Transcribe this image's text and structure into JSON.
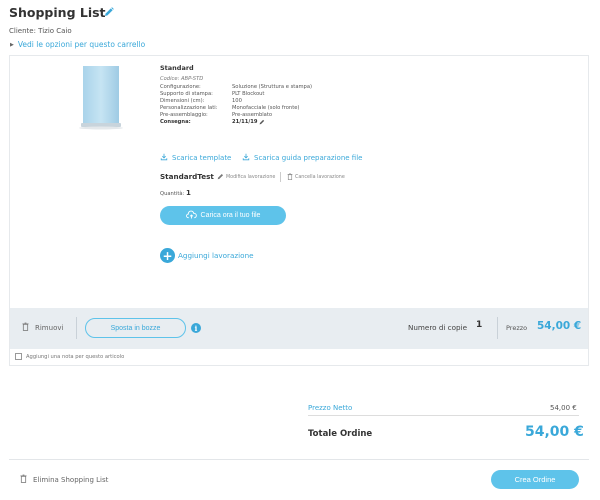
{
  "header": {
    "title": "Shopping List",
    "client": "Cliente: Tizio Caio",
    "options_link": "Vedi le opzioni per questo carrello"
  },
  "product": {
    "name": "Standard",
    "code": "Codice: ABP-STD",
    "specs": [
      {
        "key": "Configurazione:",
        "value": "Soluzione (Struttura e stampa)"
      },
      {
        "key": "Supporto di stampa:",
        "value": "PLT Blockout"
      },
      {
        "key": "Dimensioni (cm):",
        "value": "100"
      },
      {
        "key": "Personalizzazione lati:",
        "value": "Monofacciale (solo fronte)"
      },
      {
        "key": "Pre-assemblaggio:",
        "value": "Pre-assemblato"
      }
    ],
    "delivery_key": "Consegna:",
    "delivery_value": "21/11/19",
    "download_template": "Scarica template",
    "download_guide": "Scarica guida preparazione file",
    "processing": {
      "name": "StandardTest",
      "edit_label": "Modifica lavorazione",
      "cancel_label": "Cancella lavorazione",
      "quantity_label": "Quantità:",
      "quantity_value": "1"
    },
    "upload_label": "Carica ora il tuo file",
    "add_processing_label": "Aggiungi lavorazione"
  },
  "action_bar": {
    "remove_label": "Rimuovi",
    "move_label": "Sposta in bozze",
    "copies_label": "Numero di copie",
    "copies_value": "1",
    "price_label": "Prezzo",
    "price_value": "54,00 €"
  },
  "note_label": "Aggiungi una nota per questo articolo",
  "totals": {
    "net_label": "Prezzo Netto",
    "net_value": "54,00 €",
    "total_label": "Totale Ordine",
    "total_value": "54,00 €"
  },
  "footer": {
    "delete_label": "Elimina Shopping List",
    "create_label": "Crea Ordine"
  },
  "colors": {
    "accent": "#3aa8d9",
    "button": "#5ec3ea",
    "bar_bg": "#e8edf1"
  },
  "icons": {
    "edit": "pencil-icon",
    "download": "download-icon",
    "trash": "trash-icon",
    "upload": "cloud-upload-icon",
    "add": "plus-circle-icon",
    "info": "info-icon"
  }
}
